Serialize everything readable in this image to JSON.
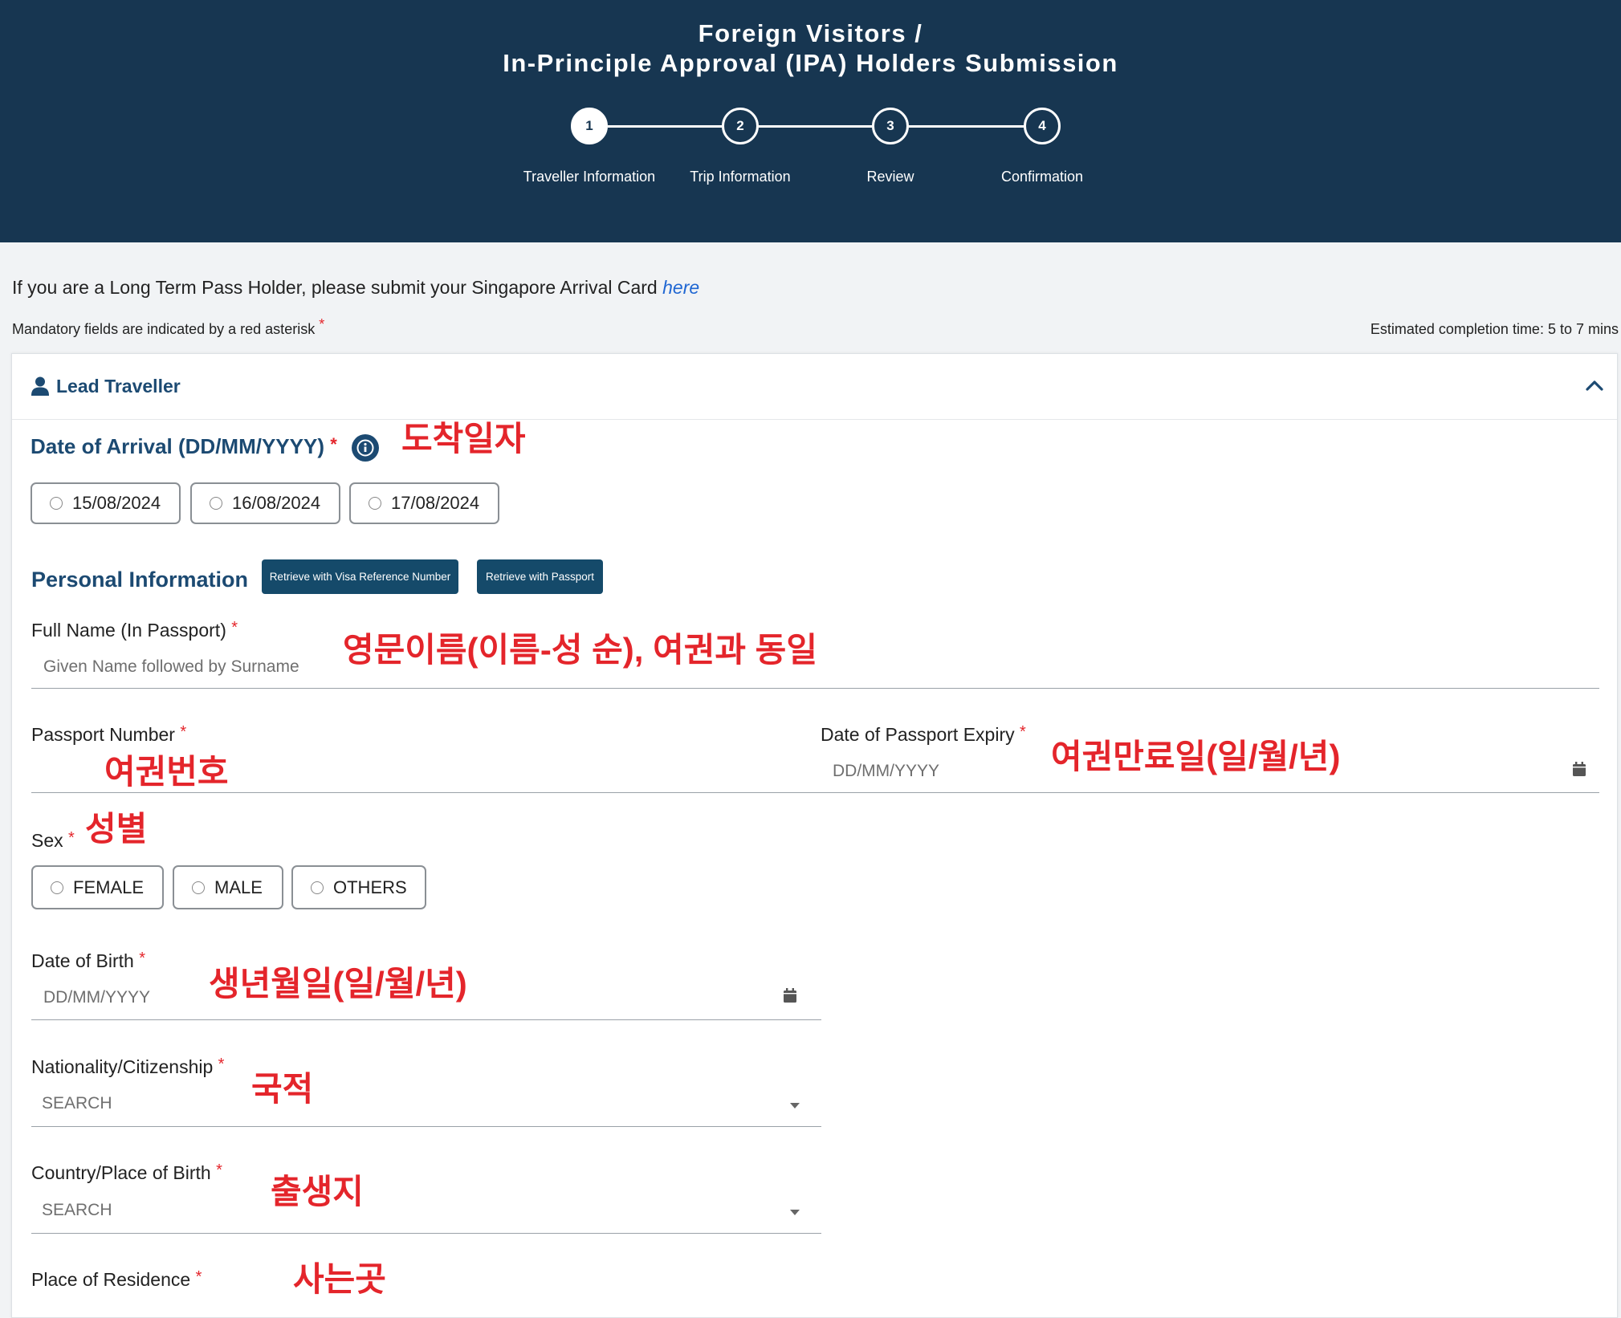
{
  "header": {
    "title_line1": "Foreign Visitors /",
    "title_line2": "In-Principle Approval (IPA) Holders Submission",
    "steps": [
      {
        "number": "1",
        "label": "Traveller Information"
      },
      {
        "number": "2",
        "label": "Trip Information"
      },
      {
        "number": "3",
        "label": "Review"
      },
      {
        "number": "4",
        "label": "Confirmation"
      }
    ]
  },
  "notice": {
    "text": "If you are a Long Term Pass Holder, please submit your Singapore Arrival Card",
    "link": "here"
  },
  "mandatory_note": "Mandatory fields are indicated by a red asterisk",
  "asterisk": "*",
  "completion_time": "Estimated completion time: 5 to 7 mins",
  "lead_traveller": {
    "title": "Lead Traveller"
  },
  "arrival": {
    "label": "Date of Arrival (DD/MM/YYYY)",
    "options": [
      "15/08/2024",
      "16/08/2024",
      "17/08/2024"
    ],
    "annotation": "도착일자"
  },
  "personal": {
    "title": "Personal Information",
    "btn_visa": "Retrieve with Visa Reference Number",
    "btn_passport": "Retrieve with Passport"
  },
  "full_name": {
    "label": "Full Name (In Passport)",
    "placeholder": "Given Name followed by Surname",
    "annotation": "영문이름(이름-성 순), 여권과 동일"
  },
  "passport_number": {
    "label": "Passport Number",
    "annotation": "여권번호"
  },
  "passport_expiry": {
    "label": "Date of Passport Expiry",
    "placeholder": "DD/MM/YYYY",
    "annotation": "여권만료일(일/월/년)"
  },
  "sex": {
    "label": "Sex",
    "options": [
      "FEMALE",
      "MALE",
      "OTHERS"
    ],
    "annotation": "성별"
  },
  "dob": {
    "label": "Date of Birth",
    "placeholder": "DD/MM/YYYY",
    "annotation": "생년월일(일/월/년)"
  },
  "nationality": {
    "label": "Nationality/Citizenship",
    "placeholder": "SEARCH",
    "annotation": "국적"
  },
  "birth_place": {
    "label": "Country/Place of Birth",
    "placeholder": "SEARCH",
    "annotation": "출생지"
  },
  "residence": {
    "label": "Place of Residence",
    "annotation": "사는곳"
  },
  "colors": {
    "header_bg": "#173651",
    "accent": "#1c4a72",
    "required": "#e4252b",
    "button": "#154a6a"
  }
}
